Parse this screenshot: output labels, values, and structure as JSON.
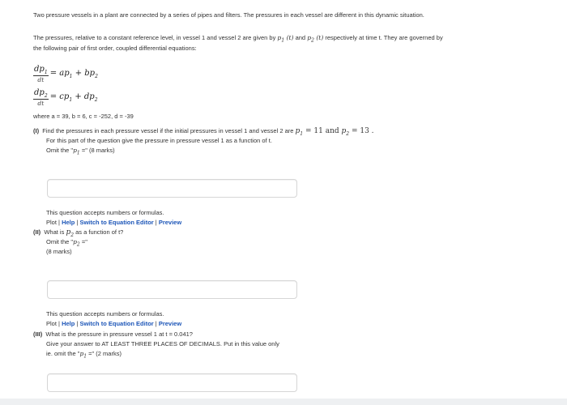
{
  "intro": {
    "line1": "Two pressure vessels in a plant are connected by a series of pipes and filters. The pressures in each vessel are different in this dynamic situation.",
    "line2a": "The pressures, relative to a constant reference level, in vessel 1 and vessel 2 are given by",
    "p1t": "p1 (t)",
    "and": "and",
    "p2t": "p2 (t)",
    "line2b": "respectively at time t. They are governed by",
    "line3": "the following pair of first order, coupled differential equations:"
  },
  "equations": {
    "eq1_num": "dp1",
    "eq1_den": "dt",
    "eq1_rhs": "= ap1 + bp2",
    "eq2_num": "dp2",
    "eq2_den": "dt",
    "eq2_rhs": "= cp1 + dp2",
    "where": "where a = 39, b = 6, c = -252, d = -39"
  },
  "q1": {
    "num": "(I)",
    "line1a": "Find the pressures in each pressure vessel if the initial pressures in vessel 1 and vessel 2 are",
    "init": "p1 = 11 and p2 = 13 .",
    "line2": "For this part of the question give the pressure in pressure vessel 1 as a function of t.",
    "omit": "Omit the \"p1 =\" (8 marks)"
  },
  "q2": {
    "num": "(II)",
    "line1": "What is p2 as a function of t?",
    "omit": "Omit the \"p2 =\"",
    "marks": "(8 marks)"
  },
  "q3": {
    "num": "(III)",
    "line1": "What is the pressure in pressure vessel 1 at t = 0.041?",
    "line2": "Give your answer to AT LEAST THREE PLACES OF DECIMALS. Put in this value only",
    "omit": "ie. omit the \"p1 =\" (2 marks)"
  },
  "help": {
    "accepts": "This question accepts numbers or formulas.",
    "plot": "Plot",
    "sep": " | ",
    "help": "Help",
    "switch": "Switch to Equation Editor",
    "preview": "Preview"
  }
}
